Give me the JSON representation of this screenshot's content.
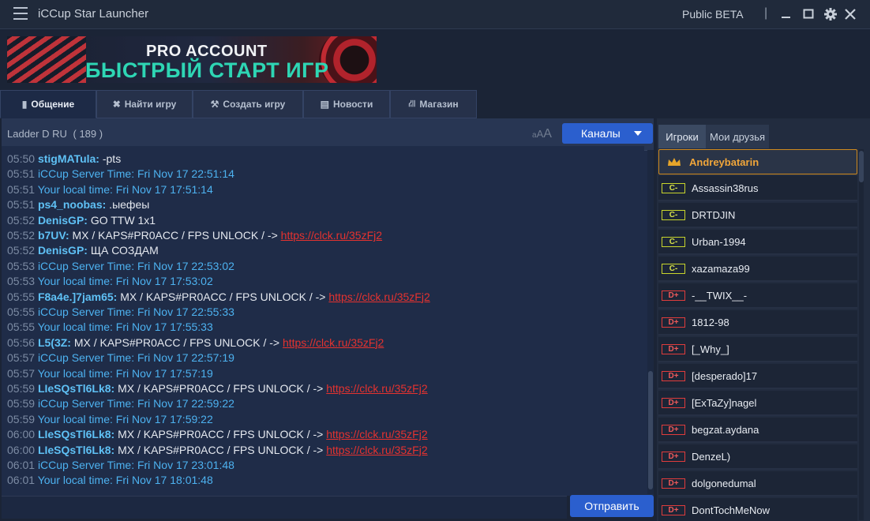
{
  "app": {
    "title": "iCCup Star Launcher",
    "edition": "Public BETA",
    "separator": "|"
  },
  "window": {
    "menu_icon": "hamburger-icon",
    "minimize_icon": "minimize-icon",
    "maximize_icon": "maximize-icon",
    "settings_icon": "gear-icon",
    "close_icon": "close-icon"
  },
  "banner": {
    "title": "PRO ACCOUNT",
    "subtitle": "БЫСТРЫЙ СТАРТ ИГР"
  },
  "tabs": [
    {
      "label": "Общение",
      "icon": "chat-icon",
      "active": true
    },
    {
      "label": "Найти игру",
      "icon": "crossed-swords-icon",
      "active": false
    },
    {
      "label": "Создать игру",
      "icon": "wrench-icon",
      "active": false
    },
    {
      "label": "Новости",
      "icon": "newspaper-icon",
      "active": false
    },
    {
      "label": "Магазин",
      "icon": "cart-icon",
      "active": false
    }
  ],
  "chat": {
    "channel": "Ladder D RU",
    "user_count": "( 189 )",
    "font_toggle": "aAA",
    "channels_button": "Каналы",
    "send_button": "Отправить",
    "messages": [
      {
        "time": "05:50",
        "nick": "stigMATula:",
        "text": " -pts",
        "link": ""
      },
      {
        "time": "05:51",
        "sys": "iCCup Server Time: Fri Nov 17 22:51:14"
      },
      {
        "time": "05:51",
        "sys": "Your local time: Fri Nov 17 17:51:14"
      },
      {
        "time": "05:51",
        "nick": "ps4_noobas:",
        "text": " .ыефеы",
        "link": ""
      },
      {
        "time": "05:52",
        "nick": "DenisGP:",
        "text": " GO TTW 1x1",
        "link": ""
      },
      {
        "time": "05:52",
        "nick": "b7UV:",
        "text": " MX / KAPS#PR0ACC / FPS UNLOCK / -> ",
        "link": "https://clck.ru/35zFj2"
      },
      {
        "time": "05:52",
        "nick": "DenisGP:",
        "text": " ЩА СОЗДАМ",
        "link": ""
      },
      {
        "time": "05:53",
        "sys": "iCCup Server Time: Fri Nov 17 22:53:02"
      },
      {
        "time": "05:53",
        "sys": "Your local time: Fri Nov 17 17:53:02"
      },
      {
        "time": "05:55",
        "nick": "F8a4e.]7jam65:",
        "text": " MX / KAPS#PR0ACC / FPS UNLOCK / -> ",
        "link": "https://clck.ru/35zFj2"
      },
      {
        "time": "05:55",
        "sys": "iCCup Server Time: Fri Nov 17 22:55:33"
      },
      {
        "time": "05:55",
        "sys": "Your local time: Fri Nov 17 17:55:33"
      },
      {
        "time": "05:56",
        "nick": "L5(3Z:",
        "text": " MX / KAPS#PR0ACC / FPS UNLOCK / -> ",
        "link": "https://clck.ru/35zFj2"
      },
      {
        "time": "05:57",
        "sys": "iCCup Server Time: Fri Nov 17 22:57:19"
      },
      {
        "time": "05:57",
        "sys": "Your local time: Fri Nov 17 17:57:19"
      },
      {
        "time": "05:59",
        "nick": "LIeSQsTl6Lk8:",
        "text": " MX / KAPS#PR0ACC / FPS UNLOCK / -> ",
        "link": "https://clck.ru/35zFj2"
      },
      {
        "time": "05:59",
        "sys": "iCCup Server Time: Fri Nov 17 22:59:22"
      },
      {
        "time": "05:59",
        "sys": "Your local time: Fri Nov 17 17:59:22"
      },
      {
        "time": "06:00",
        "nick": "LIeSQsTl6Lk8:",
        "text": " MX / KAPS#PR0ACC / FPS UNLOCK / -> ",
        "link": "https://clck.ru/35zFj2"
      },
      {
        "time": "06:00",
        "nick": "LIeSQsTl6Lk8:",
        "text": " MX / KAPS#PR0ACC / FPS UNLOCK / -> ",
        "link": "https://clck.ru/35zFj2"
      },
      {
        "time": "06:01",
        "sys": "iCCup Server Time: Fri Nov 17 23:01:48"
      },
      {
        "time": "06:01",
        "sys": "Your local time: Fri Nov 17 18:01:48"
      }
    ]
  },
  "players_panel": {
    "tabs": [
      {
        "label": "Игроки",
        "active": true
      },
      {
        "label": "Мои друзья",
        "active": false
      }
    ],
    "players": [
      {
        "name": "Andreybatarin",
        "rank": "",
        "icon": "crown-icon",
        "active": true
      },
      {
        "name": "Assassin38rus",
        "rank": "C-",
        "active": false
      },
      {
        "name": "DRTDJIN",
        "rank": "C-",
        "active": false
      },
      {
        "name": "Urban-1994",
        "rank": "C-",
        "active": false
      },
      {
        "name": "xazamaza99",
        "rank": "C-",
        "active": false
      },
      {
        "name": "-__TWIX__-",
        "rank": "D+",
        "active": false
      },
      {
        "name": "1812-98",
        "rank": "D+",
        "active": false
      },
      {
        "name": "[_Why_]",
        "rank": "D+",
        "active": false
      },
      {
        "name": "[desperado]17",
        "rank": "D+",
        "active": false
      },
      {
        "name": "[ExTaZy]nagel",
        "rank": "D+",
        "active": false
      },
      {
        "name": "begzat.aydana",
        "rank": "D+",
        "active": false
      },
      {
        "name": "DenzeL)",
        "rank": "D+",
        "active": false
      },
      {
        "name": "dolgonedumal",
        "rank": "D+",
        "active": false
      },
      {
        "name": "DontTochMeNow",
        "rank": "D+",
        "active": false
      }
    ]
  },
  "colors": {
    "accent": "#2b5fce",
    "link": "#e5322f",
    "nick": "#5fc1f5",
    "system": "#4db2f0",
    "rank_c": "#d8e24a",
    "rank_d": "#f05a5a",
    "highlight": "#f1a63a"
  }
}
